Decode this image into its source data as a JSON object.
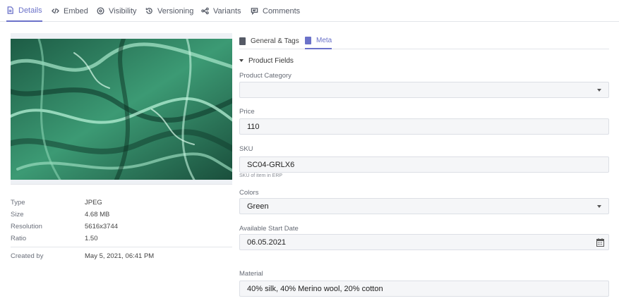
{
  "top_tabs": [
    {
      "label": "Details",
      "icon": "document-icon",
      "active": true
    },
    {
      "label": "Embed",
      "icon": "code-icon"
    },
    {
      "label": "Visibility",
      "icon": "eye-icon"
    },
    {
      "label": "Versioning",
      "icon": "history-icon"
    },
    {
      "label": "Variants",
      "icon": "variants-icon"
    },
    {
      "label": "Comments",
      "icon": "comment-icon"
    }
  ],
  "accent_color": "#6b72c9",
  "asset_info": {
    "rows": [
      {
        "label": "Type",
        "value": "JPEG"
      },
      {
        "label": "Size",
        "value": "4.68 MB"
      },
      {
        "label": "Resolution",
        "value": "5616x3744"
      },
      {
        "label": "Ratio",
        "value": "1.50"
      }
    ],
    "created": {
      "label": "Created by",
      "value": "May 5, 2021, 06:41 PM"
    }
  },
  "sub_tabs": [
    {
      "label": "General & Tags",
      "icon": "tag-page-icon"
    },
    {
      "label": "Meta",
      "icon": "meta-page-icon",
      "active": true
    }
  ],
  "section": {
    "title": "Product Fields"
  },
  "fields": {
    "category": {
      "label": "Product Category",
      "value": ""
    },
    "price": {
      "label": "Price",
      "value": "110"
    },
    "sku": {
      "label": "SKU",
      "value": "SC04-GRLX6",
      "hint": "SKU of item in ERP"
    },
    "colors": {
      "label": "Colors",
      "value": "Green"
    },
    "start_date": {
      "label": "Available Start Date",
      "value": "06.05.2021"
    },
    "material": {
      "label": "Material",
      "value": "40% silk, 40% Merino wool, 20% cotton"
    }
  }
}
